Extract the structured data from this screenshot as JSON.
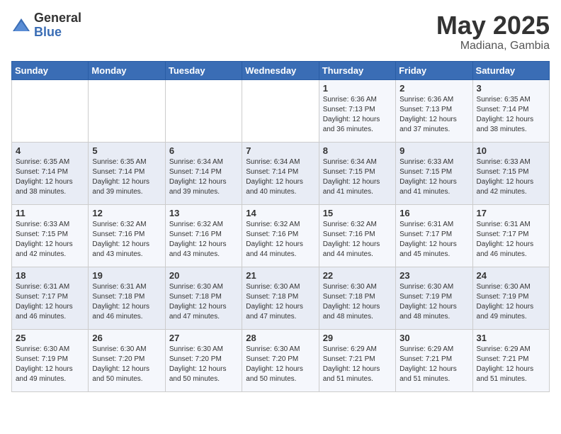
{
  "header": {
    "logo_general": "General",
    "logo_blue": "Blue",
    "title": "May 2025",
    "subtitle": "Madiana, Gambia"
  },
  "days_of_week": [
    "Sunday",
    "Monday",
    "Tuesday",
    "Wednesday",
    "Thursday",
    "Friday",
    "Saturday"
  ],
  "weeks": [
    [
      {
        "day": "",
        "sunrise": "",
        "sunset": "",
        "daylight": ""
      },
      {
        "day": "",
        "sunrise": "",
        "sunset": "",
        "daylight": ""
      },
      {
        "day": "",
        "sunrise": "",
        "sunset": "",
        "daylight": ""
      },
      {
        "day": "",
        "sunrise": "",
        "sunset": "",
        "daylight": ""
      },
      {
        "day": "1",
        "sunrise": "Sunrise: 6:36 AM",
        "sunset": "Sunset: 7:13 PM",
        "daylight": "Daylight: 12 hours and 36 minutes."
      },
      {
        "day": "2",
        "sunrise": "Sunrise: 6:36 AM",
        "sunset": "Sunset: 7:13 PM",
        "daylight": "Daylight: 12 hours and 37 minutes."
      },
      {
        "day": "3",
        "sunrise": "Sunrise: 6:35 AM",
        "sunset": "Sunset: 7:14 PM",
        "daylight": "Daylight: 12 hours and 38 minutes."
      }
    ],
    [
      {
        "day": "4",
        "sunrise": "Sunrise: 6:35 AM",
        "sunset": "Sunset: 7:14 PM",
        "daylight": "Daylight: 12 hours and 38 minutes."
      },
      {
        "day": "5",
        "sunrise": "Sunrise: 6:35 AM",
        "sunset": "Sunset: 7:14 PM",
        "daylight": "Daylight: 12 hours and 39 minutes."
      },
      {
        "day": "6",
        "sunrise": "Sunrise: 6:34 AM",
        "sunset": "Sunset: 7:14 PM",
        "daylight": "Daylight: 12 hours and 39 minutes."
      },
      {
        "day": "7",
        "sunrise": "Sunrise: 6:34 AM",
        "sunset": "Sunset: 7:14 PM",
        "daylight": "Daylight: 12 hours and 40 minutes."
      },
      {
        "day": "8",
        "sunrise": "Sunrise: 6:34 AM",
        "sunset": "Sunset: 7:15 PM",
        "daylight": "Daylight: 12 hours and 41 minutes."
      },
      {
        "day": "9",
        "sunrise": "Sunrise: 6:33 AM",
        "sunset": "Sunset: 7:15 PM",
        "daylight": "Daylight: 12 hours and 41 minutes."
      },
      {
        "day": "10",
        "sunrise": "Sunrise: 6:33 AM",
        "sunset": "Sunset: 7:15 PM",
        "daylight": "Daylight: 12 hours and 42 minutes."
      }
    ],
    [
      {
        "day": "11",
        "sunrise": "Sunrise: 6:33 AM",
        "sunset": "Sunset: 7:15 PM",
        "daylight": "Daylight: 12 hours and 42 minutes."
      },
      {
        "day": "12",
        "sunrise": "Sunrise: 6:32 AM",
        "sunset": "Sunset: 7:16 PM",
        "daylight": "Daylight: 12 hours and 43 minutes."
      },
      {
        "day": "13",
        "sunrise": "Sunrise: 6:32 AM",
        "sunset": "Sunset: 7:16 PM",
        "daylight": "Daylight: 12 hours and 43 minutes."
      },
      {
        "day": "14",
        "sunrise": "Sunrise: 6:32 AM",
        "sunset": "Sunset: 7:16 PM",
        "daylight": "Daylight: 12 hours and 44 minutes."
      },
      {
        "day": "15",
        "sunrise": "Sunrise: 6:32 AM",
        "sunset": "Sunset: 7:16 PM",
        "daylight": "Daylight: 12 hours and 44 minutes."
      },
      {
        "day": "16",
        "sunrise": "Sunrise: 6:31 AM",
        "sunset": "Sunset: 7:17 PM",
        "daylight": "Daylight: 12 hours and 45 minutes."
      },
      {
        "day": "17",
        "sunrise": "Sunrise: 6:31 AM",
        "sunset": "Sunset: 7:17 PM",
        "daylight": "Daylight: 12 hours and 46 minutes."
      }
    ],
    [
      {
        "day": "18",
        "sunrise": "Sunrise: 6:31 AM",
        "sunset": "Sunset: 7:17 PM",
        "daylight": "Daylight: 12 hours and 46 minutes."
      },
      {
        "day": "19",
        "sunrise": "Sunrise: 6:31 AM",
        "sunset": "Sunset: 7:18 PM",
        "daylight": "Daylight: 12 hours and 46 minutes."
      },
      {
        "day": "20",
        "sunrise": "Sunrise: 6:30 AM",
        "sunset": "Sunset: 7:18 PM",
        "daylight": "Daylight: 12 hours and 47 minutes."
      },
      {
        "day": "21",
        "sunrise": "Sunrise: 6:30 AM",
        "sunset": "Sunset: 7:18 PM",
        "daylight": "Daylight: 12 hours and 47 minutes."
      },
      {
        "day": "22",
        "sunrise": "Sunrise: 6:30 AM",
        "sunset": "Sunset: 7:18 PM",
        "daylight": "Daylight: 12 hours and 48 minutes."
      },
      {
        "day": "23",
        "sunrise": "Sunrise: 6:30 AM",
        "sunset": "Sunset: 7:19 PM",
        "daylight": "Daylight: 12 hours and 48 minutes."
      },
      {
        "day": "24",
        "sunrise": "Sunrise: 6:30 AM",
        "sunset": "Sunset: 7:19 PM",
        "daylight": "Daylight: 12 hours and 49 minutes."
      }
    ],
    [
      {
        "day": "25",
        "sunrise": "Sunrise: 6:30 AM",
        "sunset": "Sunset: 7:19 PM",
        "daylight": "Daylight: 12 hours and 49 minutes."
      },
      {
        "day": "26",
        "sunrise": "Sunrise: 6:30 AM",
        "sunset": "Sunset: 7:20 PM",
        "daylight": "Daylight: 12 hours and 50 minutes."
      },
      {
        "day": "27",
        "sunrise": "Sunrise: 6:30 AM",
        "sunset": "Sunset: 7:20 PM",
        "daylight": "Daylight: 12 hours and 50 minutes."
      },
      {
        "day": "28",
        "sunrise": "Sunrise: 6:30 AM",
        "sunset": "Sunset: 7:20 PM",
        "daylight": "Daylight: 12 hours and 50 minutes."
      },
      {
        "day": "29",
        "sunrise": "Sunrise: 6:29 AM",
        "sunset": "Sunset: 7:21 PM",
        "daylight": "Daylight: 12 hours and 51 minutes."
      },
      {
        "day": "30",
        "sunrise": "Sunrise: 6:29 AM",
        "sunset": "Sunset: 7:21 PM",
        "daylight": "Daylight: 12 hours and 51 minutes."
      },
      {
        "day": "31",
        "sunrise": "Sunrise: 6:29 AM",
        "sunset": "Sunset: 7:21 PM",
        "daylight": "Daylight: 12 hours and 51 minutes."
      }
    ]
  ]
}
